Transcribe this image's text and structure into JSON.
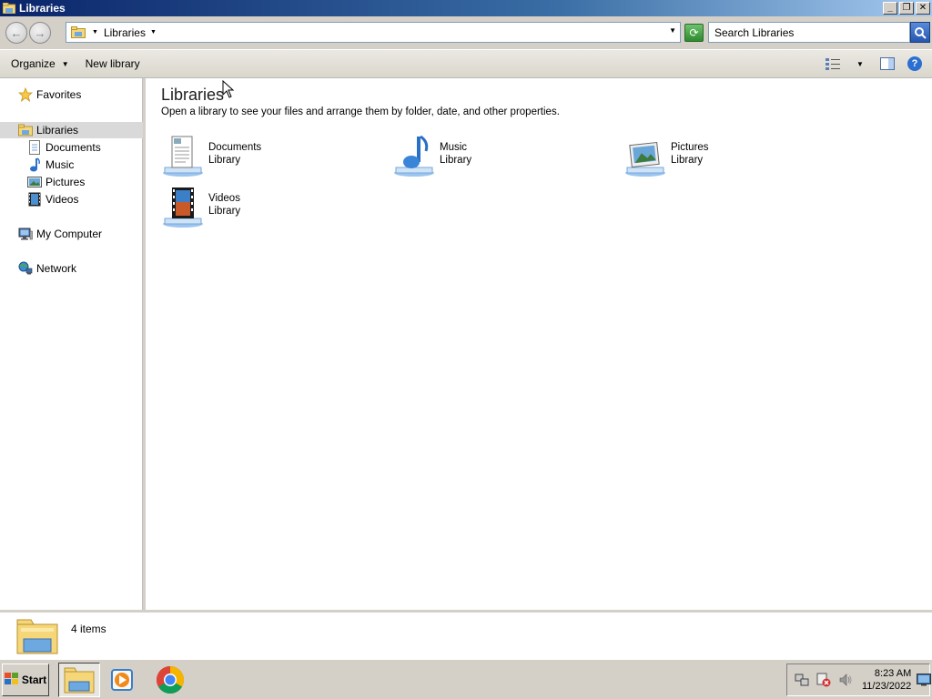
{
  "window": {
    "title": "Libraries"
  },
  "address": {
    "crumb": "Libraries",
    "search_placeholder": "Search Libraries"
  },
  "toolbar": {
    "organize_label": "Organize",
    "new_library_label": "New library"
  },
  "nav": {
    "favorites": "Favorites",
    "libraries": "Libraries",
    "documents": "Documents",
    "music": "Music",
    "pictures": "Pictures",
    "videos": "Videos",
    "my_computer": "My Computer",
    "network": "Network"
  },
  "main": {
    "title": "Libraries",
    "description": "Open a library to see your files and arrange them by folder, date, and other properties.",
    "items": [
      {
        "name": "Documents",
        "type": "Library"
      },
      {
        "name": "Music",
        "type": "Library"
      },
      {
        "name": "Pictures",
        "type": "Library"
      },
      {
        "name": "Videos",
        "type": "Library"
      }
    ]
  },
  "details": {
    "count": "4 items"
  },
  "taskbar": {
    "start_label": "Start",
    "time": "8:23 AM",
    "date": "11/23/2022"
  },
  "colors": {
    "title_bar": "#0a246a",
    "selection": "#d9d9d9",
    "accent": "#2a6fd1"
  }
}
